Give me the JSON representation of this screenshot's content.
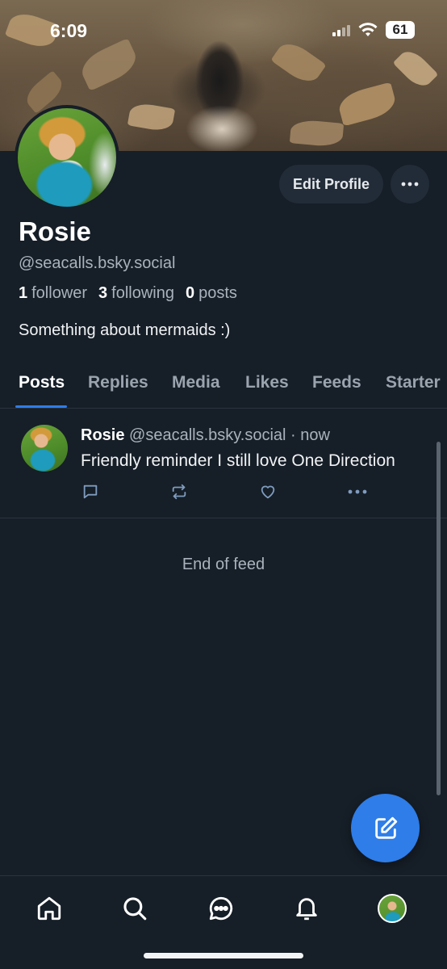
{
  "status_bar": {
    "time": "6:09",
    "battery": "61"
  },
  "profile": {
    "edit_label": "Edit Profile",
    "display_name": "Rosie",
    "handle": "@seacalls.bsky.social",
    "stats": {
      "followers_count": "1",
      "followers_label": "follower",
      "following_count": "3",
      "following_label": "following",
      "posts_count": "0",
      "posts_label": "posts"
    },
    "bio": "Something about mermaids :)"
  },
  "tabs": [
    {
      "label": "Posts",
      "active": true
    },
    {
      "label": "Replies",
      "active": false
    },
    {
      "label": "Media",
      "active": false
    },
    {
      "label": "Likes",
      "active": false
    },
    {
      "label": "Feeds",
      "active": false
    },
    {
      "label": "Starter",
      "active": false
    }
  ],
  "post": {
    "author": "Rosie",
    "handle": "@seacalls.bsky.social",
    "separator": "·",
    "time": "now",
    "text": "Friendly reminder I still love One Direction"
  },
  "feed_end": "End of feed",
  "icons": {
    "reply": "reply-icon",
    "repost": "repost-icon",
    "like": "heart-icon",
    "more": "more-icon",
    "compose": "compose-icon",
    "home": "home-icon",
    "search": "search-icon",
    "chat": "chat-icon",
    "notifications": "bell-icon"
  },
  "colors": {
    "background": "#161e27",
    "accent": "#2e7de9",
    "muted": "#aab3bd"
  }
}
